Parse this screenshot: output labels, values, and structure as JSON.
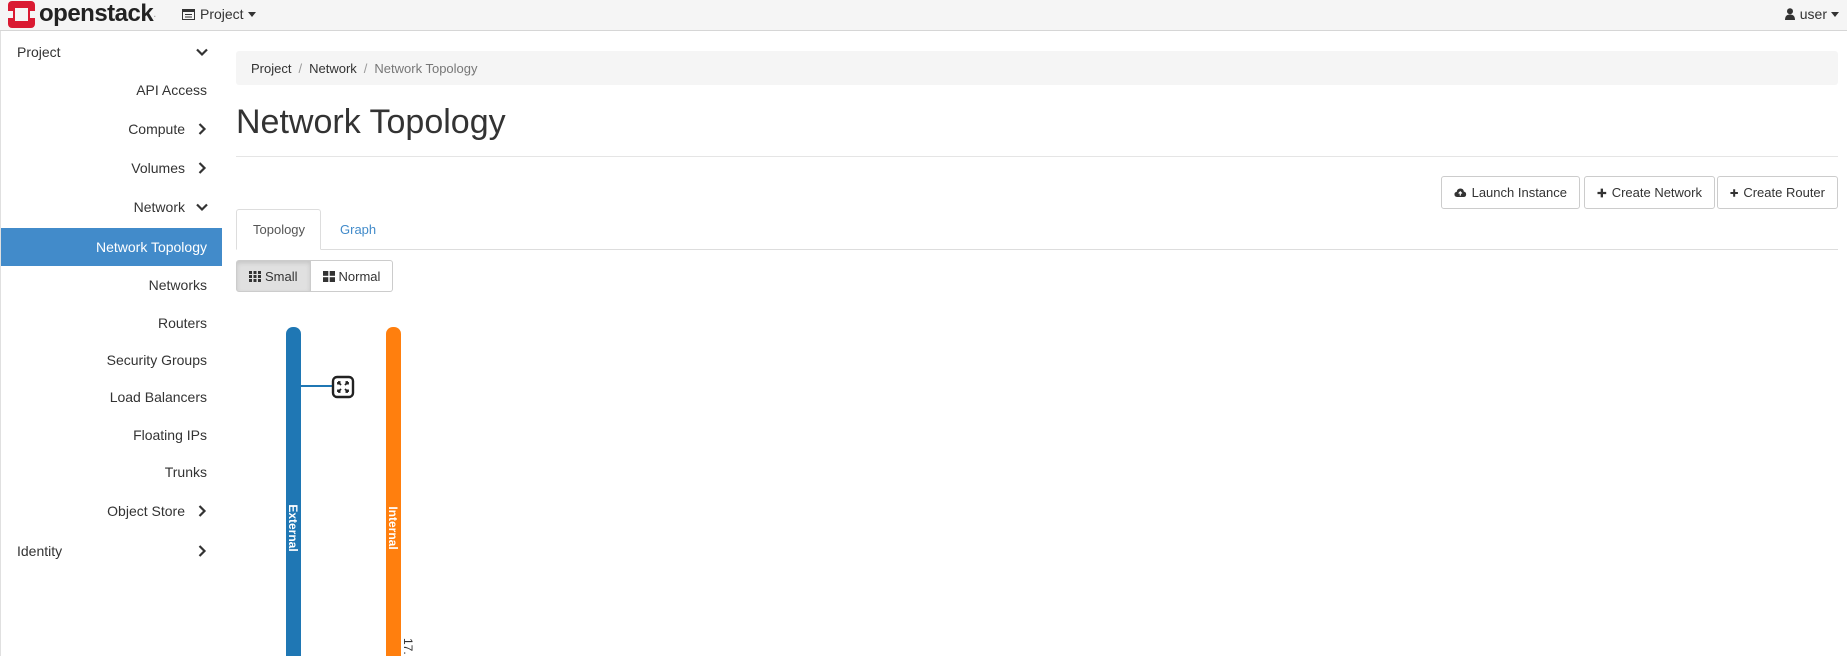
{
  "brand": {
    "name": "openstack",
    "mark": "."
  },
  "navbar": {
    "project_label": "Project",
    "user_label": "user"
  },
  "sidebar": {
    "items": [
      {
        "label": "Project"
      },
      {
        "label": "API Access"
      },
      {
        "label": "Compute"
      },
      {
        "label": "Volumes"
      },
      {
        "label": "Network"
      },
      {
        "label": "Network Topology"
      },
      {
        "label": "Networks"
      },
      {
        "label": "Routers"
      },
      {
        "label": "Security Groups"
      },
      {
        "label": "Load Balancers"
      },
      {
        "label": "Floating IPs"
      },
      {
        "label": "Trunks"
      },
      {
        "label": "Object Store"
      },
      {
        "label": "Identity"
      }
    ]
  },
  "breadcrumb": {
    "items": [
      "Project",
      "Network",
      "Network Topology"
    ]
  },
  "page": {
    "title": "Network Topology"
  },
  "actions": {
    "launch_instance": "Launch Instance",
    "create_network": "Create Network",
    "create_router": "Create Router"
  },
  "tabs": {
    "topology": "Topology",
    "graph": "Graph"
  },
  "size_toggle": {
    "small": "Small",
    "normal": "Normal"
  },
  "topology": {
    "networks": [
      {
        "name": "External",
        "color": "#1f77b4"
      },
      {
        "name": "Internal",
        "color": "#ff7f0e",
        "cidr_partial": "17."
      }
    ]
  },
  "colors": {
    "accent": "#428bca",
    "external": "#1f77b4",
    "internal": "#ff7f0e"
  }
}
